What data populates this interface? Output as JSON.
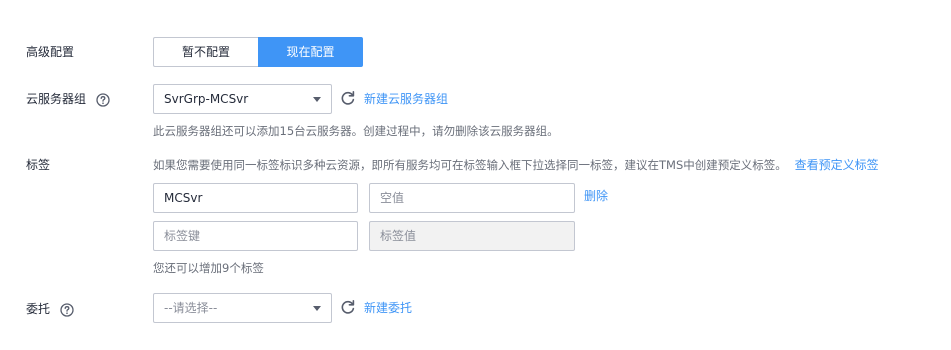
{
  "advanced": {
    "label": "高级配置",
    "options": [
      "暂不配置",
      "现在配置"
    ]
  },
  "server_group": {
    "label": "云服务器组",
    "help_icon": "question-circle-icon",
    "selected": "SvrGrp-MCSvr",
    "refresh_icon": "refresh-icon",
    "create_link": "新建云服务器组",
    "hint": "此云服务器组还可以添加15台云服务器。创建过程中，请勿删除该云服务器组。"
  },
  "tags": {
    "label": "标签",
    "description": "如果您需要使用同一标签标识多种云资源，即所有服务均可在标签输入框下拉选择同一标签，建议在TMS中创建预定义标签。",
    "view_link": "查看预定义标签",
    "rows": [
      {
        "key": "MCSvr",
        "value_placeholder": "空值",
        "delete_label": "删除"
      },
      {
        "key_placeholder": "标签键",
        "value_placeholder": "标签值"
      }
    ],
    "remaining": "您还可以增加9个标签"
  },
  "agency": {
    "label": "委托",
    "help_icon": "question-circle-icon",
    "placeholder": "--请选择--",
    "refresh_icon": "refresh-icon",
    "create_link": "新建委托"
  },
  "colors": {
    "accent": "#3f95f6",
    "text": "#252b3a",
    "hint": "#6a6f7a",
    "border": "#c3c7d1"
  }
}
